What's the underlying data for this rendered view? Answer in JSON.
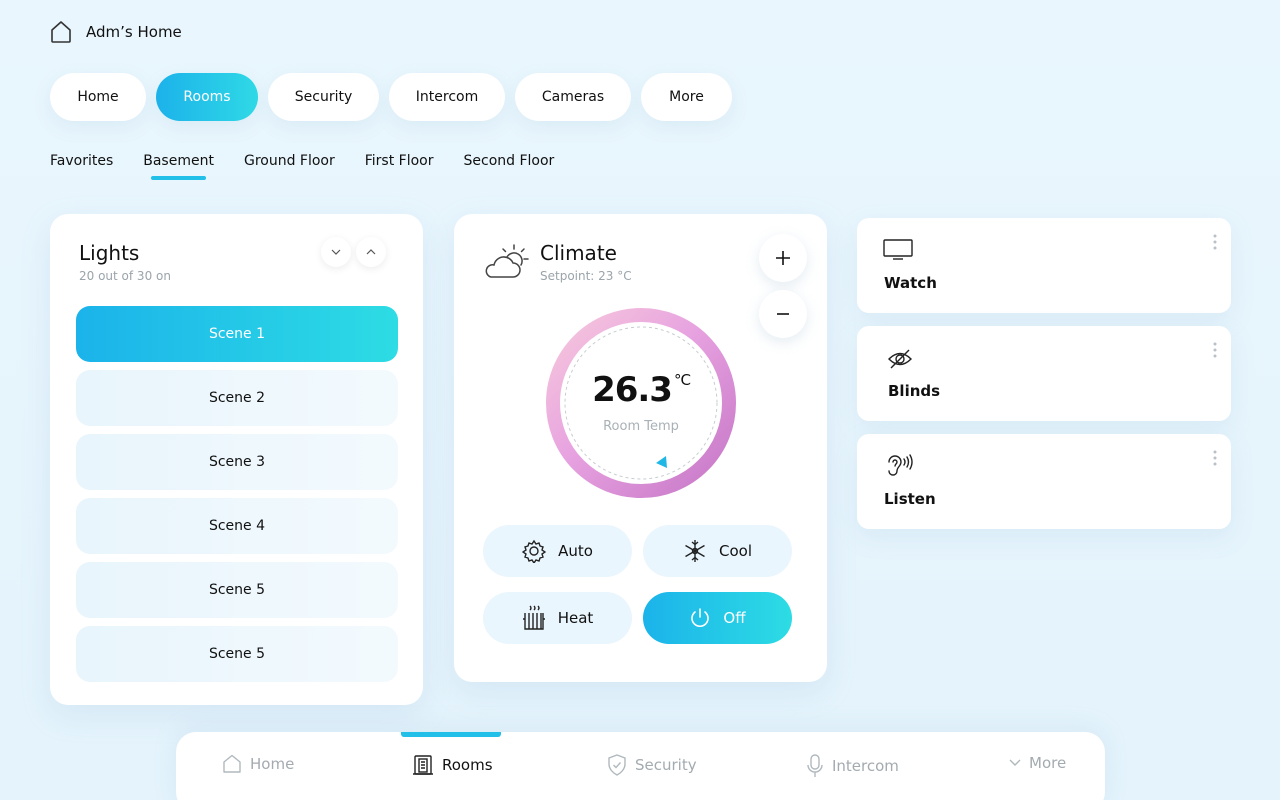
{
  "header": {
    "title": "Adm’s Home",
    "icon": "house-icon"
  },
  "top_tabs": [
    "Home",
    "Rooms",
    "Security",
    "Intercom",
    "Cameras",
    "More"
  ],
  "top_tabs_active": "Rooms",
  "floors": [
    "Favorites",
    "Basement",
    "Ground Floor",
    "First Floor",
    "Second Floor"
  ],
  "floors_active": "Basement",
  "lights": {
    "title": "Lights",
    "subtitle": "20 out of 30 on",
    "scenes": [
      "Scene 1",
      "Scene 2",
      "Scene 3",
      "Scene 4",
      "Scene 5",
      "Scene 5"
    ],
    "active_scene": "Scene 1"
  },
  "climate": {
    "title": "Climate",
    "setpoint": "Setpoint: 23 °C",
    "temp": "26.3",
    "unit": "°C",
    "temp_label": "Room Temp",
    "modes": {
      "auto": "Auto",
      "cool": "Cool",
      "heat": "Heat",
      "off": "Off"
    },
    "active_mode": "Off"
  },
  "devices": [
    {
      "label": "Watch",
      "icon": "tv-icon"
    },
    {
      "label": "Blinds",
      "icon": "eye-off-icon"
    },
    {
      "label": "Listen",
      "icon": "ear-icon"
    }
  ],
  "bottom_nav": {
    "home": "Home",
    "rooms": "Rooms",
    "security": "Security",
    "intercom": "Intercom",
    "more": "More",
    "active": "Rooms"
  },
  "colors": {
    "accent_start": "#1bb3ea",
    "accent_end": "#2ddce4",
    "background": "#e9f6fd"
  }
}
